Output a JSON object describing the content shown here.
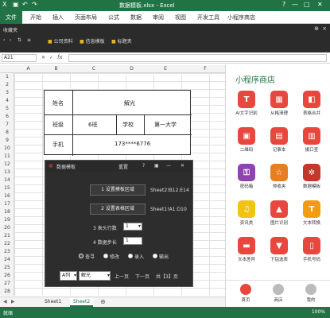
{
  "window": {
    "title": "数据模板.xlsx - Excel",
    "quick_access": [
      "↶",
      "↷"
    ],
    "controls": [
      "?",
      "—",
      "□",
      "✕"
    ]
  },
  "ribbon": {
    "file_tab": "文件",
    "tabs": [
      "开始",
      "插入",
      "页面布局",
      "公式",
      "数据",
      "审阅",
      "视图",
      "开发工具",
      "小程序商店"
    ]
  },
  "favorites": {
    "label": "收藏夹",
    "items": [
      "公司资料",
      "信息模板",
      "标题夹"
    ]
  },
  "formula_bar": {
    "name_box": "A21",
    "fx": "fx"
  },
  "columns": [
    "A",
    "B",
    "C",
    "D",
    "E",
    "F"
  ],
  "rows": [
    "1",
    "2",
    "3",
    "4",
    "5",
    "6",
    "7",
    "8",
    "9",
    "10",
    "11",
    "12",
    "13",
    "14",
    "15",
    "16",
    "17",
    "18",
    "19",
    "20",
    "21",
    "22",
    "23",
    "24",
    "25",
    "26",
    "27",
    "28"
  ],
  "info_table": {
    "name_label": "姓名",
    "name_value": "解光",
    "class_label": "班级",
    "class_value": "6班",
    "school_label": "学校",
    "school_value": "第一大学",
    "phone_label": "手机",
    "phone_value": "173****6776"
  },
  "sheet_tabs": [
    "Sheet1",
    "Sheet2"
  ],
  "dialog": {
    "title": "数据模板",
    "reset": "重置",
    "help": "?",
    "btn_template": "1  设置模板区域",
    "template_range": "Sheet2!B12:E14",
    "btn_table": "2  设置表格区域",
    "table_range": "Sheet1!A1:D10",
    "header_rows_label": "3  表头行数",
    "header_rows_value": "1",
    "step_label": "4  数据步长",
    "step_value": "1",
    "modes": [
      "查寻",
      "修改",
      "录入",
      "输出"
    ],
    "active_mode": 0,
    "col_select": "A列",
    "value_select": "解光",
    "prev": "上一页",
    "next": "下一页",
    "page_total": "共【3】页"
  },
  "panel": {
    "title": "小程序商店",
    "apps": [
      {
        "label": "AI文字识别",
        "color": "#e8473d",
        "glyph": "T"
      },
      {
        "label": "从格清理",
        "color": "#e8473d",
        "glyph": "▦"
      },
      {
        "label": "表格合并",
        "color": "#e8473d",
        "glyph": "◧"
      },
      {
        "label": "二维码",
        "color": "#e8473d",
        "glyph": "▣"
      },
      {
        "label": "记事本",
        "color": "#e8473d",
        "glyph": "▤"
      },
      {
        "label": "摄口查",
        "color": "#e8473d",
        "glyph": "▥"
      },
      {
        "label": "密码箱",
        "color": "#8e44ad",
        "glyph": "⚿"
      },
      {
        "label": "帅收夹",
        "color": "#e67e22",
        "glyph": "☆"
      },
      {
        "label": "数据模板",
        "color": "#c0392b",
        "glyph": "✲"
      },
      {
        "label": "资讯类",
        "color": "#f1c40f",
        "glyph": "♫"
      },
      {
        "label": "图片识别",
        "color": "#e8473d",
        "glyph": "▲"
      },
      {
        "label": "文本转换",
        "color": "#f39c12",
        "glyph": "T"
      },
      {
        "label": "文本差异",
        "color": "#e8473d",
        "glyph": "▬"
      },
      {
        "label": "下钻选表",
        "color": "#e8473d",
        "glyph": "▼"
      },
      {
        "label": "手机号码",
        "color": "#e8473d",
        "glyph": "▯"
      }
    ],
    "nav": [
      "首页",
      "商店",
      "我的"
    ]
  },
  "status": {
    "left": "就绪",
    "zoom": "100%"
  }
}
